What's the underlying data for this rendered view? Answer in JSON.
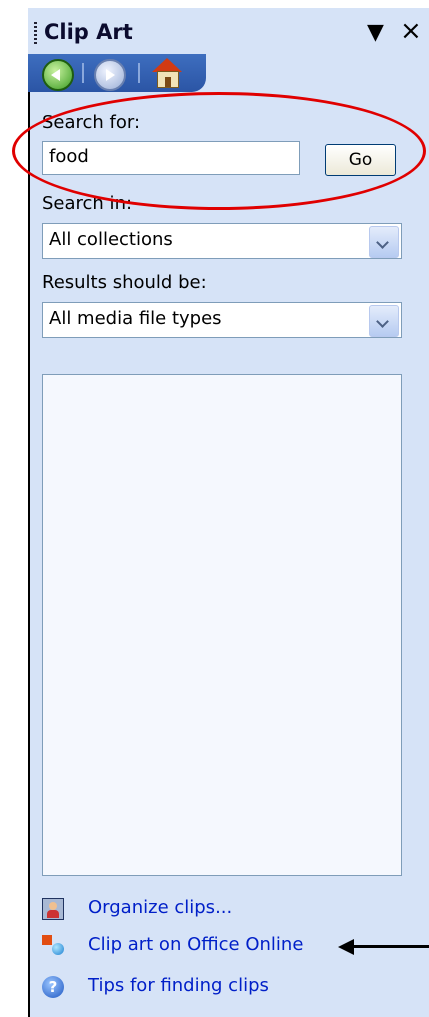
{
  "title_bar": {
    "title": "Clip Art",
    "dropdown_icon": "triangle-down-icon",
    "close_label": "×"
  },
  "nav": {
    "back_icon": "back-arrow-icon",
    "forward_icon": "forward-arrow-icon",
    "home_icon": "home-icon"
  },
  "search": {
    "label": "Search for:",
    "value": "food",
    "go_label": "Go"
  },
  "search_in": {
    "label": "Search in:",
    "selected": "All collections"
  },
  "results_type": {
    "label": "Results should be:",
    "selected": "All media file types"
  },
  "links": [
    {
      "label": "Organize clips...",
      "icon": "organize-clips-icon"
    },
    {
      "label": "Clip art on Office Online",
      "icon": "office-online-icon"
    },
    {
      "label": "Tips for finding clips",
      "icon": "help-icon"
    }
  ],
  "colors": {
    "pane_background": "#d6e3f7",
    "link": "#001fc8",
    "annotation": "#e00000"
  }
}
